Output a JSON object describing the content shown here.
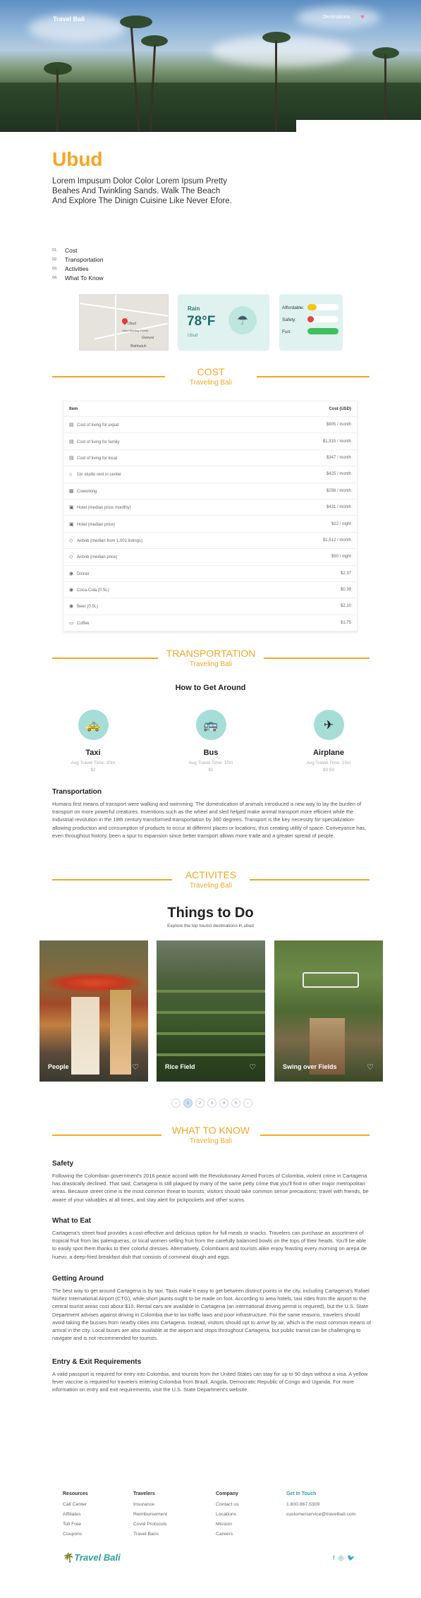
{
  "nav": {
    "brand": "Travel Bali",
    "link": "Destinations"
  },
  "hero": {
    "title": "Ubud",
    "lead": "Lorem Impusum Dolor Color Lorem Ipsum Pretty Beahes And Twinkling Sands. Walk The Beach And Explore The Dinign Cuisine Like Never Efore."
  },
  "toc": [
    {
      "num": "01.",
      "label": "Cost"
    },
    {
      "num": "02.",
      "label": "Transportation"
    },
    {
      "num": "03.",
      "label": "Activities"
    },
    {
      "num": "04.",
      "label": "What To Know"
    }
  ],
  "map": {
    "labels": [
      "Ubud",
      "Gianyar",
      "Blahbatuh",
      "Ubud Monkey Forest"
    ]
  },
  "weather": {
    "condition": "Rain",
    "temp": "78°F",
    "location": "Ubud",
    "icon": "cloud-rain-icon"
  },
  "ratings": [
    {
      "label": "Affordable:",
      "level": 0.3,
      "color": "#f5c518"
    },
    {
      "label": "Safety:",
      "level": 0.2,
      "color": "#e94040"
    },
    {
      "label": "Fun:",
      "level": 1.0,
      "color": "#3fbf5f"
    }
  ],
  "cost": {
    "title": "COST",
    "subtitle": "Traveling Bali",
    "head_item": "Item",
    "head_cost": "Cost (USD)",
    "rows": [
      {
        "icon": "▤",
        "item": "Cost of living for expat",
        "cost": "$905 / month"
      },
      {
        "icon": "▤",
        "item": "Cost of living for family",
        "cost": "$1,915 / month"
      },
      {
        "icon": "▤",
        "item": "Cost of living for local",
        "cost": "$347 / month"
      },
      {
        "icon": "⌂",
        "item": "1br studio rent in center",
        "cost": "$425 / month"
      },
      {
        "icon": "▦",
        "item": "Coworking",
        "cost": "$256 / month"
      },
      {
        "icon": "▣",
        "item": "Hotel (median price monthly)",
        "cost": "$431 / month"
      },
      {
        "icon": "▣",
        "item": "Hotel (median price)",
        "cost": "$22 / night"
      },
      {
        "icon": "◇",
        "item": "Airbnb (median from 1,001 listings)",
        "cost": "$1,512 / month"
      },
      {
        "icon": "◇",
        "item": "Airbnb (median price)",
        "cost": "$50 / night"
      },
      {
        "icon": "◉",
        "item": "Dinner",
        "cost": "$2.37"
      },
      {
        "icon": "◉",
        "item": "Coca-Cola (0.5L)",
        "cost": "$0.39"
      },
      {
        "icon": "◉",
        "item": "Beer (0.5L)",
        "cost": "$2.10"
      },
      {
        "icon": "▭",
        "item": "Coffee",
        "cost": "$1.75"
      }
    ]
  },
  "transport": {
    "title": "TRANSPORTATION",
    "subtitle": "Traveling Bali",
    "heading": "How to Get Around",
    "modes": [
      {
        "icon": "taxi-icon",
        "name": "Taxi",
        "time": "Avg Travel Time: 20m",
        "price": "$2"
      },
      {
        "icon": "bus-icon",
        "name": "Bus",
        "time": "Avg Travel Time: 10m",
        "price": "$1"
      },
      {
        "icon": "airplane-icon",
        "name": "Airplane",
        "time": "Avg Travel Time: 15m",
        "price": "$0.50"
      }
    ],
    "para_title": "Transportation",
    "para": "Humans first means of transport were walking and swimming. The domestication of animals introduced a new way to lay the burden of transport on more powerful creatures. Inventions such as the wheel and sled helped make animal transport more efficient while the Industrial revolution in the 19th century transformed transportation by 360 degrees. Transport is the key necessity for specialization- allowing production and consumption of products to occur at different places or locations, thus creating utility of space. Conveyance has, even throughout history, been a spur to expansion since better transport allows more trade and a greater spread of people."
  },
  "activities": {
    "title": "ACTIVITES",
    "subtitle": "Traveling Bali",
    "heading": "Things to Do",
    "sub": "Explore the top tourist destinations in ubud",
    "photos": [
      {
        "caption": "People"
      },
      {
        "caption": "Rice Field"
      },
      {
        "caption": "Swing over Fields"
      }
    ],
    "pages": [
      "‹",
      "1",
      "2",
      "3",
      "4",
      "5",
      "›"
    ],
    "current_page": "1"
  },
  "know": {
    "title": "WHAT TO KNOW",
    "subtitle": "Traveling Bali",
    "sections": [
      {
        "title": "Safety",
        "text": "Following the Colombian government's 2016 peace accord with the Revolutionary Armed Forces of Colombia, violent crime in Cartagena has drastically declined. That said, Cartagena is still plagued by many of the same petty crime that you'll find in other major metropolitan areas. Because street crime is the most common threat to tourists, visitors should take common sense precautions: travel with friends, be aware of your valuables at all times, and stay alert for pickpockets and other scams."
      },
      {
        "title": "What to Eat",
        "text": "Cartagena's street food provides a cost-effective and delicious option for full meals or snacks. Travelers can purchase an assortment of tropical fruit from las palenqueras, or local women selling fruit from the carefully balanced bowls on the tops of their heads. You'll be able to easily spot them thanks to their colorful dresses. Alternatively, Colombians and tourists alike enjoy feasting every morning on arepa de huevo, a deep-fried breakfast dish that consists of cornmeal dough and eggs."
      },
      {
        "title": "Getting Around",
        "text": "The best way to get around Cartagena is by taxi. Taxis make it easy to get between distinct points in the city, including Cartagena's Rafael Núñez International Airport (CTG), while short jaunts ought to be made on foot. According to area hotels, taxi rides from the airport to the central tourist areas cost about $10. Rental cars are available in Cartagena (an international driving permit is required), but the U.S. State Department advises against driving in Colombia due to lax traffic laws and poor infrastructure. For the same reasons, travelers should avoid taking the busses from nearby cities into Cartagena. Instead, visitors should opt to arrive by air, which is the most common means of arrival in the city. Local buses are also available at the airport and stops throughout Cartagena, but public transit can be challenging to navigate and is not recommended for tourists."
      },
      {
        "title": "Entry & Exit Requirements",
        "text": "A valid passport is required for entry into Colombia, and tourists from the United States can stay for up to 90 days without a visa. A yellow fever vaccine is required for travelers entering Colombia from Brazil, Angola, Democratic Republic of Congo and Uganda. For more information on entry and exit requirements, visit the U.S. State Department's website."
      }
    ]
  },
  "footer": {
    "cols": [
      {
        "title": "Resources",
        "items": [
          "Call Center",
          "Affiliates",
          "Toll Free",
          "Coupons"
        ]
      },
      {
        "title": "Travelers",
        "items": [
          "Insurance",
          "Reimbursement",
          "Covid Protocols",
          "Travel Bans"
        ]
      },
      {
        "title": "Company",
        "items": [
          "Contact us",
          "Locations",
          "Mission",
          "Careers"
        ]
      },
      {
        "title": "Get In Touch",
        "items": [
          "1.800.867.5309",
          "customerservice@travelbali.com"
        ]
      }
    ],
    "logo": "Travel Bali",
    "social": [
      "facebook-icon",
      "instagram-icon",
      "twitter-icon"
    ]
  },
  "colors": {
    "accent": "#f5a623",
    "teal": "#2fa19a",
    "mint": "#dff2ef"
  }
}
